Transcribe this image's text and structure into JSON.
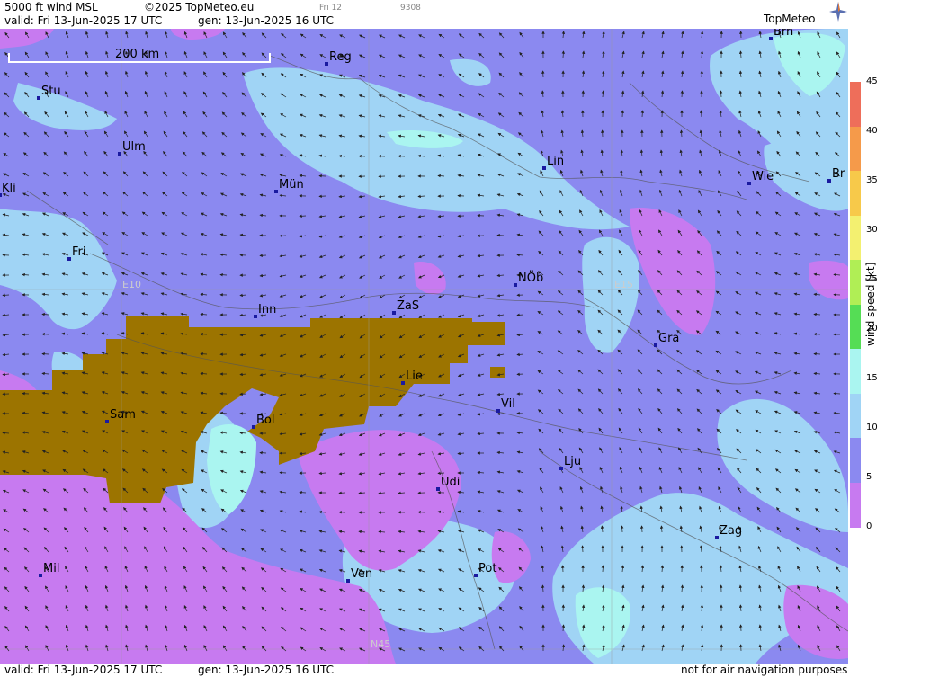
{
  "header": {
    "product": "5000 ft wind MSL",
    "copyright": "©2025 TopMeteo.eu",
    "small1": "Fri 12",
    "small2": "9308",
    "valid": "valid:  Fri  13-Jun-2025  17 UTC",
    "gen": "gen: 13-Jun-2025 16 UTC",
    "logo": "TopMeteo"
  },
  "footer": {
    "valid": "valid:  Fri  13-Jun-2025  17 UTC",
    "gen": "gen: 13-Jun-2025 16 UTC",
    "disclaimer": "not for air navigation purposes"
  },
  "scale": {
    "label": "200 km"
  },
  "grid_labels": [
    "E10",
    "E15",
    "N45"
  ],
  "legend": {
    "title": "wind  speed  [kt]",
    "ticks": [
      "45",
      "40",
      "35",
      "30",
      "25",
      "20",
      "15",
      "10",
      "5",
      "0"
    ],
    "colors": [
      "#ee6e5a",
      "#f59a4a",
      "#f7c94a",
      "#f3f070",
      "#b0ee55",
      "#55dd55",
      "#aaf5f0",
      "#a0d4f5",
      "#8b89f0",
      "#c77af0"
    ]
  },
  "cities": [
    {
      "name": "Brn"
    },
    {
      "name": "Reg"
    },
    {
      "name": "Stu"
    },
    {
      "name": "Ulm"
    },
    {
      "name": "Lin"
    },
    {
      "name": "Wie"
    },
    {
      "name": "Br"
    },
    {
      "name": "Kli"
    },
    {
      "name": "Mün"
    },
    {
      "name": "Fri"
    },
    {
      "name": "NÖb"
    },
    {
      "name": "Inn"
    },
    {
      "name": "ZaS"
    },
    {
      "name": "Gra"
    },
    {
      "name": "Lie"
    },
    {
      "name": "Vil"
    },
    {
      "name": "Sam"
    },
    {
      "name": "Bol"
    },
    {
      "name": "Lju"
    },
    {
      "name": "Udi"
    },
    {
      "name": "Zag"
    },
    {
      "name": "Mil"
    },
    {
      "name": "Ven"
    },
    {
      "name": "Pot"
    }
  ]
}
